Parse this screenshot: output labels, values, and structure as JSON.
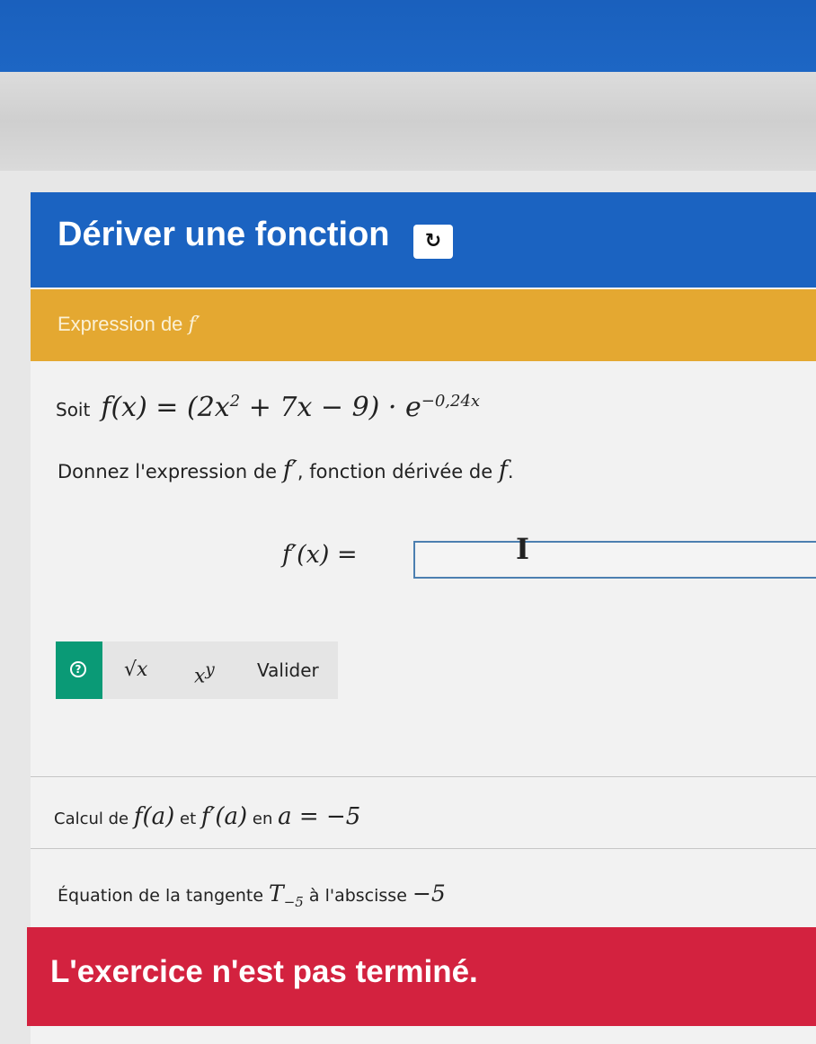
{
  "header": {
    "title": "Dériver une fonction",
    "refresh_icon": "↻"
  },
  "section": {
    "title": "Expression de ",
    "title_symbol": "f′"
  },
  "statement": {
    "prefix": "Soit",
    "formula_lhs": "f(x) = (2x",
    "formula_exp1": "2",
    "formula_mid": " + 7x − 9) · e",
    "formula_exp2": "−0,24x"
  },
  "instruction": {
    "part1": "Donnez l'expression de ",
    "symbol1": "f′",
    "part2": ", fonction dérivée de ",
    "symbol2": "f",
    "part3": "."
  },
  "answer": {
    "label": "f′(x) =",
    "value": "",
    "cursor_glyph": "I"
  },
  "toolbar": {
    "help_icon": "?",
    "sqrt_label": "√x",
    "power_label_base": "x",
    "power_label_exp": "y",
    "validate_label": "Valider"
  },
  "steps": {
    "calc": {
      "t1": "Calcul de ",
      "m1": "f(a)",
      "t2": " et ",
      "m2": "f′(a)",
      "t3": " en ",
      "m3": "a = −5"
    },
    "tangent": {
      "t1": "Équation de la tangente ",
      "m1": "T",
      "m1_sub": "−5",
      "t2": " à l'abscisse ",
      "m2": "−5"
    }
  },
  "status": {
    "text": "L'exercice n'est pas terminé."
  },
  "colors": {
    "header_blue": "#1b63c1",
    "section_orange": "#e4a831",
    "help_green": "#0a9a76",
    "status_red": "#d3223f"
  }
}
